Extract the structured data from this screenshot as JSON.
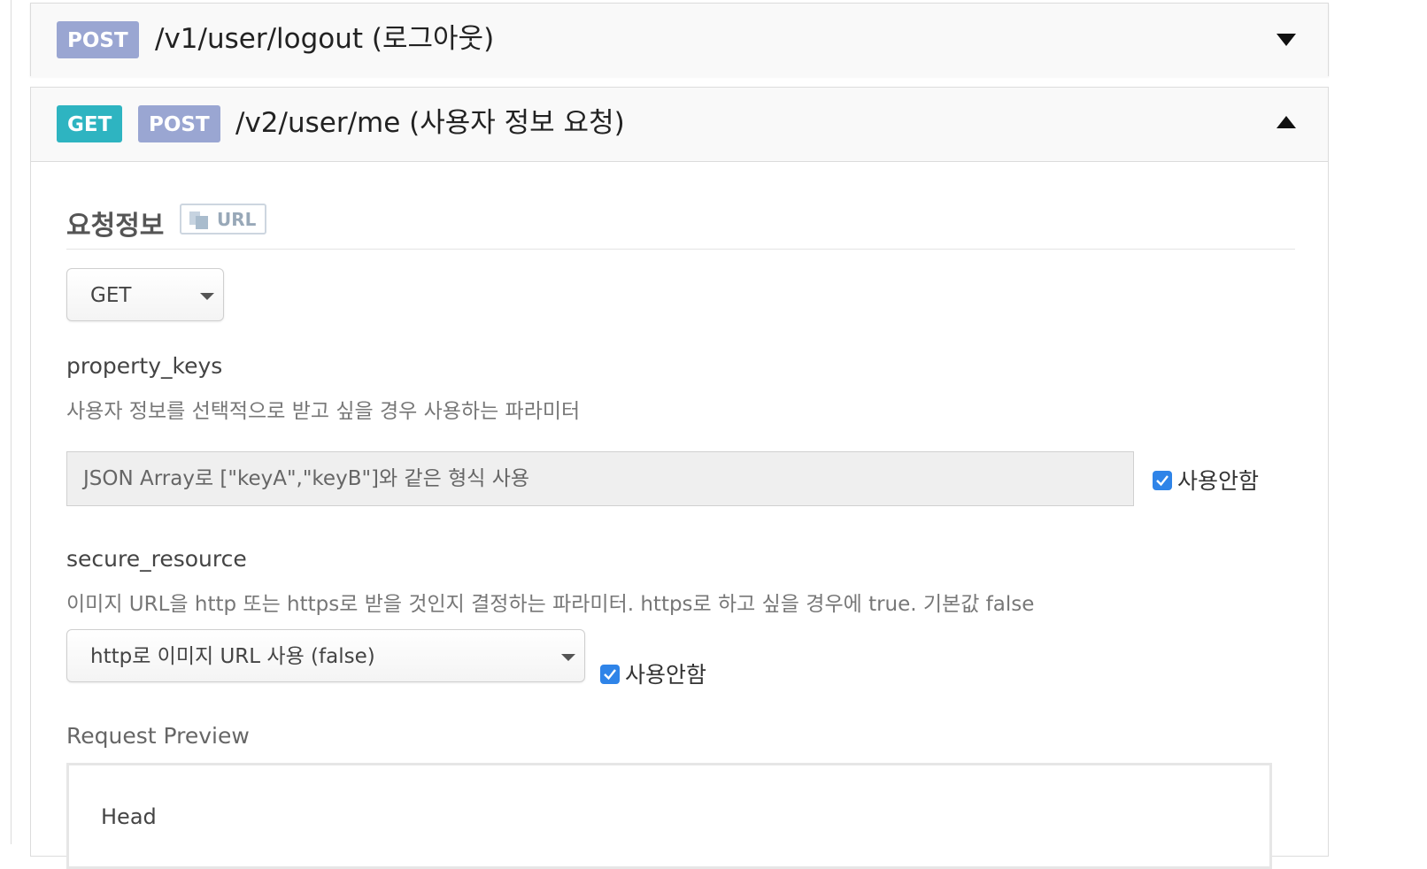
{
  "endpoints": [
    {
      "methods": [
        "POST"
      ],
      "path": "/v1/user/logout (로그아웃)",
      "expanded": false
    },
    {
      "methods": [
        "GET",
        "POST"
      ],
      "path": "/v2/user/me (사용자 정보 요청)",
      "expanded": true
    }
  ],
  "request_info": {
    "title": "요청정보",
    "url_button": "URL",
    "method_select": {
      "value": "GET"
    },
    "params": [
      {
        "name": "property_keys",
        "description": "사용자 정보를 선택적으로 받고 싶을 경우 사용하는 파라미터",
        "placeholder": "JSON Array로 [\"keyA\",\"keyB\"]와 같은 형식 사용",
        "disable_label": "사용안함",
        "disabled_checked": true
      },
      {
        "name": "secure_resource",
        "description": "이미지 URL을 http 또는 https로 받을 것인지 결정하는 파라미터. https로 하고 싶을 경우에 true. 기본값 false",
        "select_value": "http로 이미지 URL 사용 (false)",
        "disable_label": "사용안함",
        "disabled_checked": true
      }
    ],
    "preview_label": "Request Preview",
    "preview_peek": "Head"
  },
  "colors": {
    "post_badge": "#9aa6d2",
    "get_badge": "#2eb4c1",
    "checkbox": "#2f84e8"
  }
}
